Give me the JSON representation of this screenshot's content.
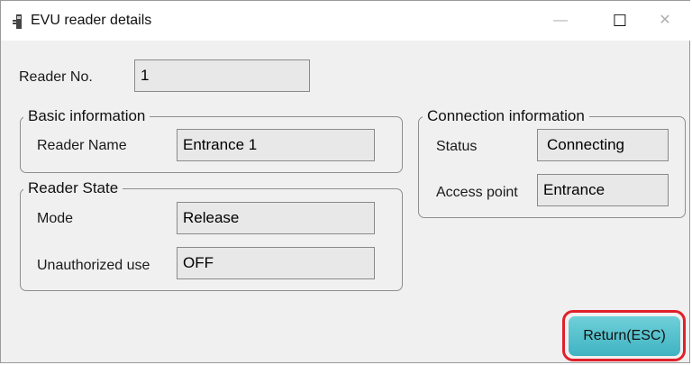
{
  "window": {
    "title": "EVU reader details",
    "minimize": "—",
    "maximize": "☐",
    "close": "✕"
  },
  "reader_no": {
    "label": "Reader No.",
    "value": "1"
  },
  "basic_information": {
    "title": "Basic information",
    "reader_name_label": "Reader Name",
    "reader_name_value": "Entrance 1"
  },
  "reader_state": {
    "title": "Reader State",
    "mode_label": "Mode",
    "mode_value": "Release",
    "unauthorized_label": "Unauthorized use",
    "unauthorized_value": "OFF"
  },
  "connection_information": {
    "title": "Connection information",
    "status_label": "Status",
    "status_value": "Connecting",
    "access_point_label": "Access point",
    "access_point_value": "Entrance"
  },
  "return_button": {
    "label": "Return(ESC)"
  },
  "colors": {
    "accent_button": "#4fc1cd",
    "highlight_outline": "#e0202a"
  }
}
